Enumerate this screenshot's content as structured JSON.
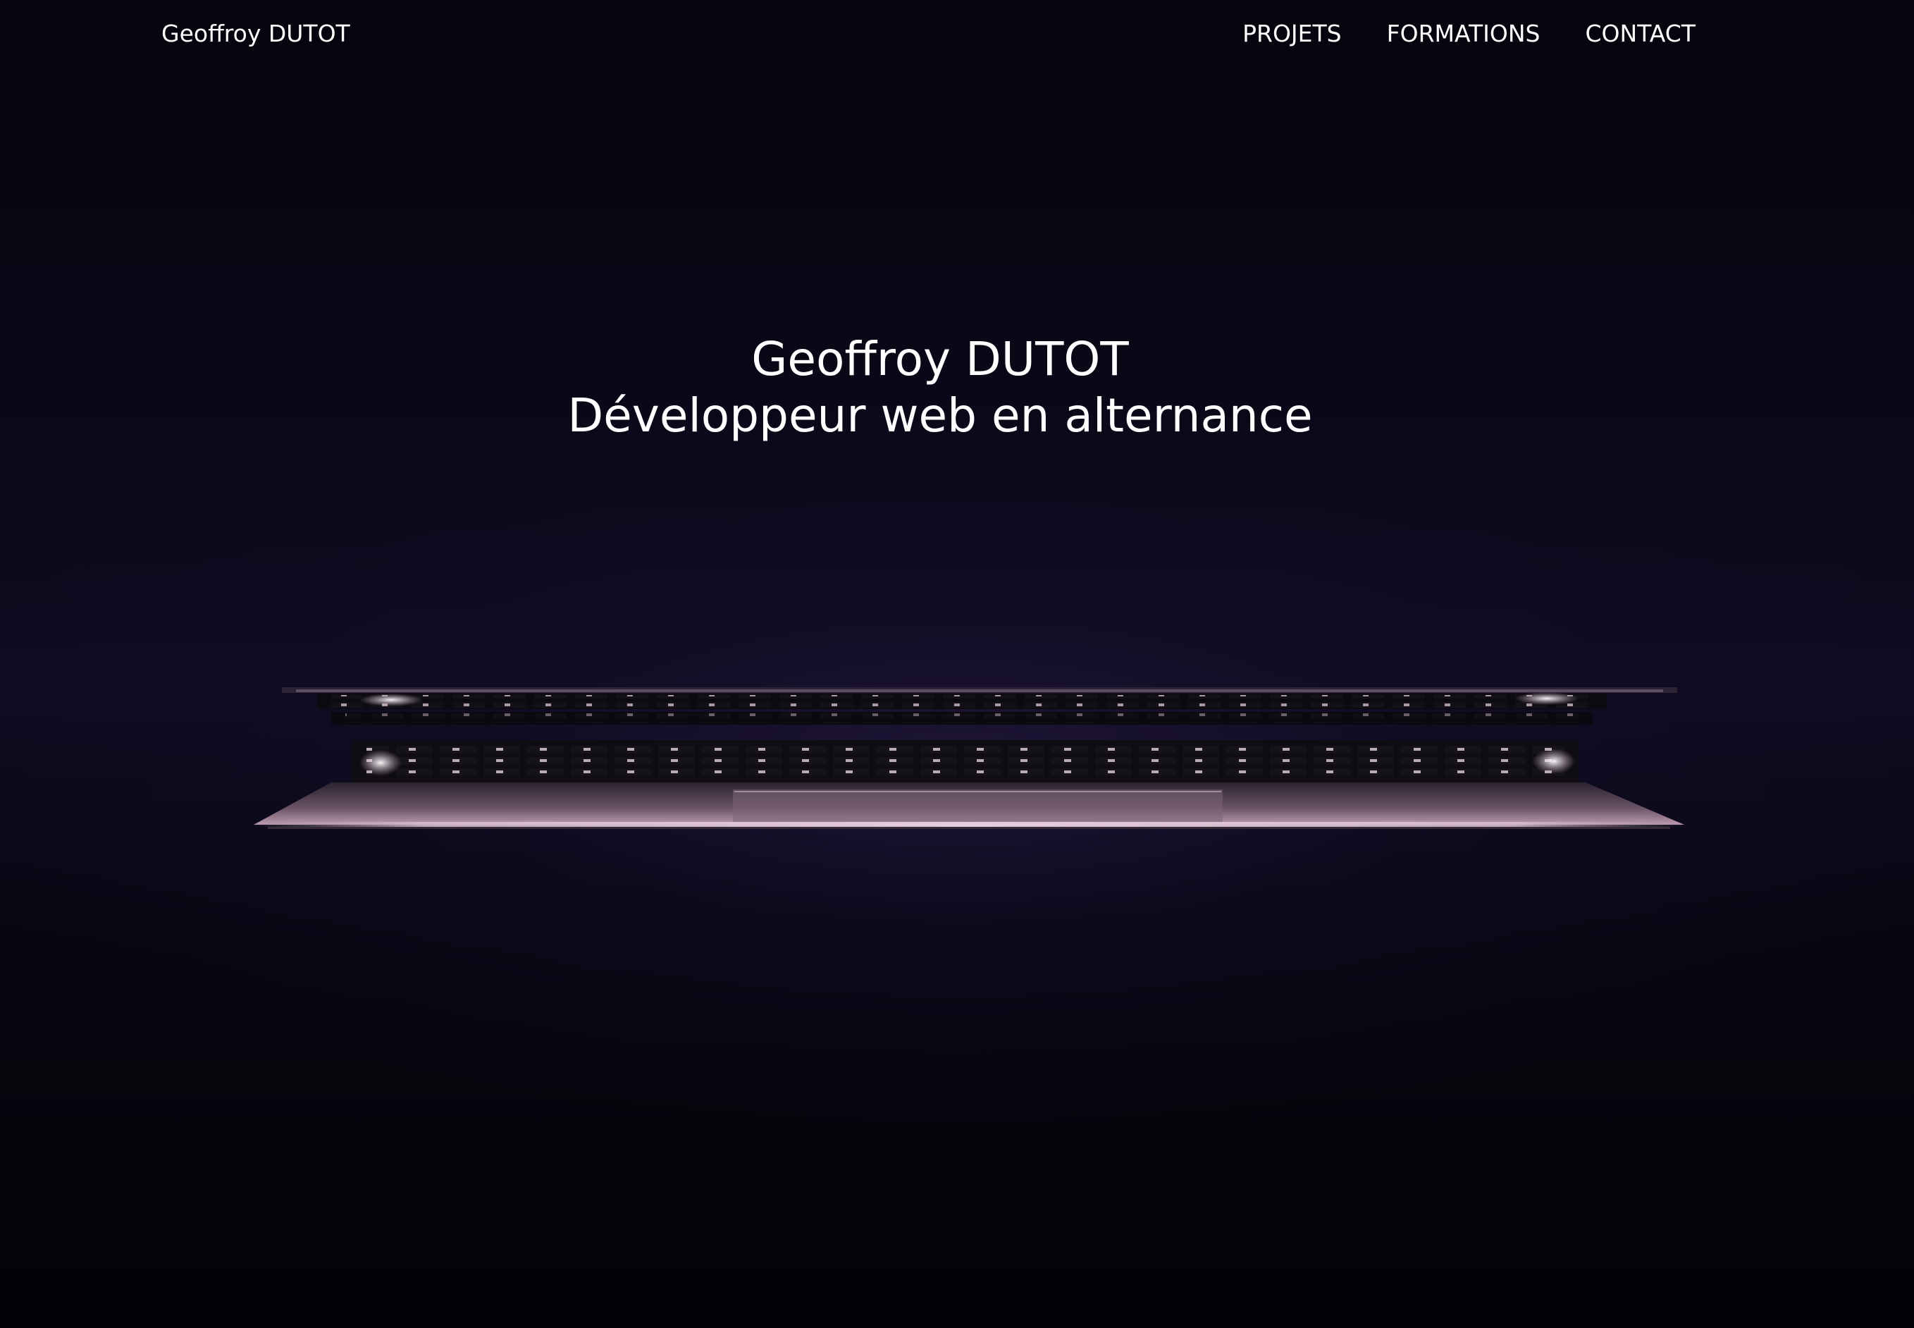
{
  "nav": {
    "brand": "Geoffroy DUTOT",
    "links": [
      {
        "label": "PROJETS"
      },
      {
        "label": "FORMATIONS"
      },
      {
        "label": "CONTACT"
      }
    ]
  },
  "hero": {
    "title": "Geoffroy DUTOT",
    "subtitle": "Développeur web en alternance",
    "background_image": "laptop-keyboard-glow-photo"
  },
  "colors": {
    "background": "#04030a",
    "text": "#ffffff",
    "keyboard_glow": "#c9a9bd"
  }
}
